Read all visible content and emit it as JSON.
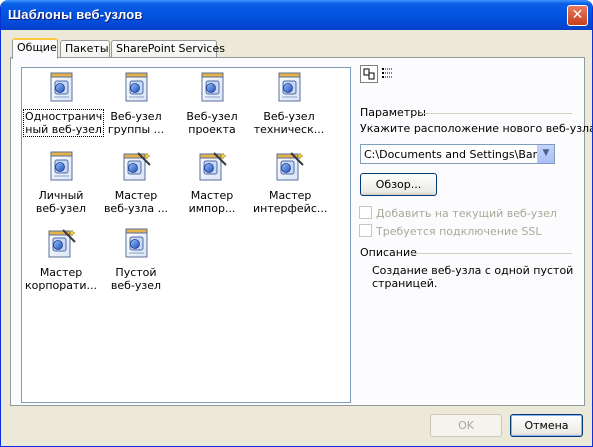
{
  "window": {
    "title": "Шаблоны веб-узлов",
    "close_glyph": "✕"
  },
  "tabs": [
    {
      "label": "Общие",
      "active": true
    },
    {
      "label": "Пакеты",
      "active": false
    },
    {
      "label": "SharePoint Services",
      "active": false
    }
  ],
  "templates": [
    {
      "label_line1": "Одностранич",
      "label_line2": "ный веб-узел",
      "icon": "single-page-web-icon",
      "selected": true
    },
    {
      "label_line1": "Веб-узел",
      "label_line2": "группы ...",
      "icon": "team-web-icon"
    },
    {
      "label_line1": "Веб-узел",
      "label_line2": "проекта",
      "icon": "project-web-icon"
    },
    {
      "label_line1": "Веб-узел",
      "label_line2": "техническ...",
      "icon": "support-web-icon"
    },
    {
      "label_line1": "Личный",
      "label_line2": "веб-узел",
      "icon": "personal-web-icon"
    },
    {
      "label_line1": "Мастер",
      "label_line2": "веб-узла ...",
      "icon": "wizard-web-icon"
    },
    {
      "label_line1": "Мастер",
      "label_line2": "импор...",
      "icon": "import-wizard-icon"
    },
    {
      "label_line1": "Мастер",
      "label_line2": "интерфейс...",
      "icon": "interface-wizard-icon"
    },
    {
      "label_line1": "Мастер",
      "label_line2": "корпорати...",
      "icon": "corporate-wizard-icon"
    },
    {
      "label_line1": "Пустой",
      "label_line2": "веб-узел",
      "icon": "empty-web-icon"
    }
  ],
  "options": {
    "group_label": "Параметры",
    "location_label": "Укажите расположение нового веб-узла:",
    "location_value": "C:\\Documents and Settings\\Barter\\M",
    "browse_label": "Обзор...",
    "add_to_current_label": "Добавить на текущий веб-узел",
    "ssl_label": "Требуется подключение SSL"
  },
  "description": {
    "group_label": "Описание",
    "line1": "Создание веб-узла с одной пустой",
    "line2": "страницей."
  },
  "buttons": {
    "ok": "OK",
    "cancel": "Отмена"
  },
  "colors": {
    "titlebar": "#0454e2",
    "tab_highlight": "#ffc83c",
    "dialog_bg": "#ece9d8"
  }
}
